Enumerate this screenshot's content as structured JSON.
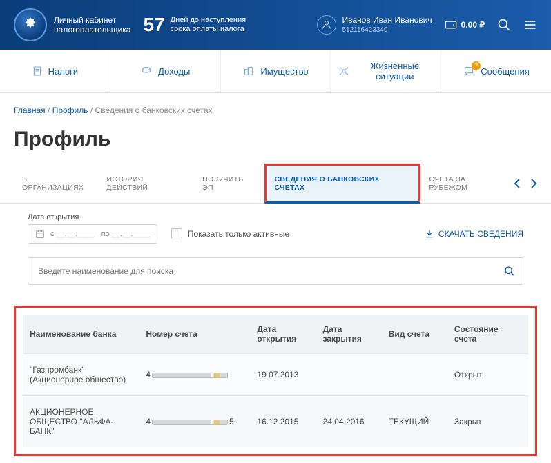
{
  "header": {
    "site_title_1": "Личный кабинет",
    "site_title_2": "налогоплательщика",
    "days_count": "57",
    "days_text_1": "Дней до наступления",
    "days_text_2": "срока оплаты налога",
    "user_name": "Иванов Иван Иванович",
    "user_id": "512116423340",
    "balance": "0.00 ₽"
  },
  "nav": {
    "items": [
      {
        "label": "Налоги"
      },
      {
        "label": "Доходы"
      },
      {
        "label": "Имущество"
      },
      {
        "label": "Жизненные ситуации"
      },
      {
        "label": "Сообщения",
        "badge": "7"
      }
    ]
  },
  "breadcrumb": {
    "home": "Главная",
    "profile": "Профиль",
    "current": "Сведения о банковских счетах"
  },
  "page_title": "Профиль",
  "tabs": [
    {
      "label": "В ОРГАНИЗАЦИЯХ"
    },
    {
      "label": "ИСТОРИЯ ДЕЙСТВИЙ"
    },
    {
      "label": "ПОЛУЧИТЬ ЭП"
    },
    {
      "label": "СВЕДЕНИЯ О БАНКОВСКИХ СЧЕТАХ",
      "active": true
    },
    {
      "label": "СЧЕТА ЗА РУБЕЖОМ"
    }
  ],
  "filter": {
    "date_label": "Дата открытия",
    "from_prefix": "с",
    "from_placeholder": "__.__.____",
    "to_prefix": "по",
    "to_placeholder": "__.__.____",
    "active_only": "Показать только активные",
    "download": "СКАЧАТЬ СВЕДЕНИЯ"
  },
  "search": {
    "placeholder": "Введите наименование для поиска"
  },
  "table": {
    "headers": {
      "bank": "Наименование банка",
      "account": "Номер счета",
      "opened": "Дата открытия",
      "closed": "Дата закрытия",
      "type": "Вид счета",
      "status": "Состояние счета"
    },
    "rows": [
      {
        "bank": "\"Газпромбанк\" (Акционерное общество)",
        "acc_prefix": "4",
        "acc_suffix": "",
        "opened": "19.07.2013",
        "closed": "",
        "type": "",
        "status": "Открыт"
      },
      {
        "bank": "АКЦИОНЕРНОЕ ОБЩЕСТВО \"АЛЬФА-БАНК\"",
        "acc_prefix": "4",
        "acc_suffix": "5",
        "opened": "16.12.2015",
        "closed": "24.04.2016",
        "type": "ТЕКУЩИЙ",
        "status": "Закрыт"
      }
    ]
  }
}
